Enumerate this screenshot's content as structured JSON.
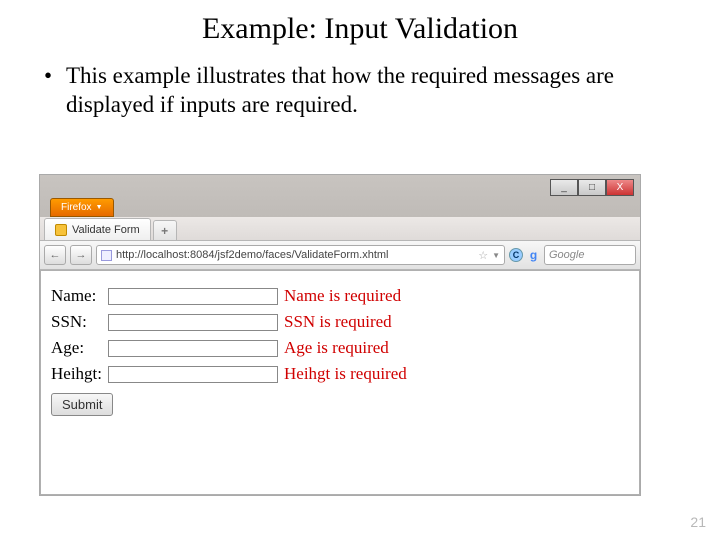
{
  "slide": {
    "title": "Example: Input Validation",
    "bullet": "This example illustrates that how the required messages are displayed if inputs are required.",
    "page_num": "21"
  },
  "browser": {
    "app_badge": "Firefox",
    "win": {
      "min": "_",
      "max": "□",
      "close": "X"
    },
    "tab": {
      "title": "Validate Form",
      "plus": "+"
    },
    "nav": {
      "back": "←",
      "fwd": "→",
      "url": "http://localhost:8084/jsf2demo/faces/ValidateForm.xhtml",
      "star": "☆",
      "reload_c": "C",
      "google_g": "g",
      "search_placeholder": "Google"
    }
  },
  "form": {
    "rows": [
      {
        "label": "Name:",
        "error": "Name is required"
      },
      {
        "label": "SSN:",
        "error": "SSN is required"
      },
      {
        "label": "Age:",
        "error": "Age is required"
      },
      {
        "label": "Heihgt:",
        "error": "Heihgt is required"
      }
    ],
    "submit": "Submit"
  }
}
